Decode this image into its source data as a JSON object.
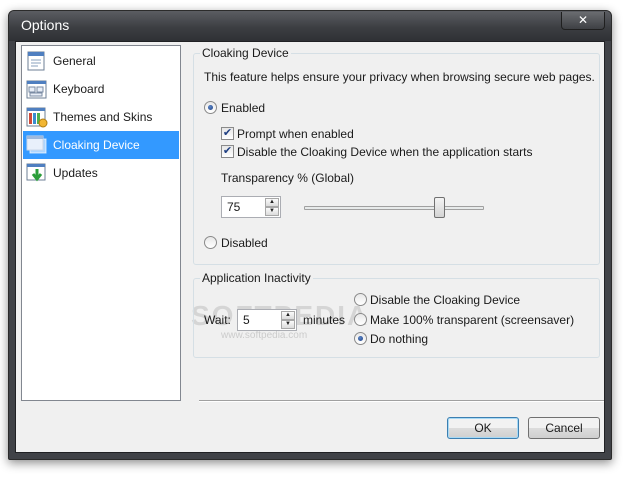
{
  "window": {
    "title": "Options",
    "close_glyph": "✕"
  },
  "nav": {
    "items": [
      {
        "label": "General",
        "icon": "general-icon"
      },
      {
        "label": "Keyboard",
        "icon": "keyboard-icon"
      },
      {
        "label": "Themes and Skins",
        "icon": "themes-icon"
      },
      {
        "label": "Cloaking Device",
        "icon": "cloaking-icon",
        "selected": true
      },
      {
        "label": "Updates",
        "icon": "updates-icon"
      }
    ]
  },
  "cloaking": {
    "group_title": "Cloaking Device",
    "description": "This feature helps ensure your privacy when browsing secure web pages.",
    "enabled_label": "Enabled",
    "enabled_selected": true,
    "prompt_label": "Prompt when enabled",
    "prompt_checked": true,
    "disable_on_start_label": "Disable the Cloaking Device when the application starts",
    "disable_on_start_checked": true,
    "transparency_label": "Transparency % (Global)",
    "transparency_value": "75",
    "transparency_slider_fraction": 0.75,
    "disabled_label": "Disabled"
  },
  "inactivity": {
    "group_title": "Application Inactivity",
    "wait_label": "Wait:",
    "wait_value": "5",
    "minutes_label": "minutes",
    "options": [
      {
        "label": "Disable the Cloaking Device",
        "selected": false
      },
      {
        "label": "Make 100% transparent (screensaver)",
        "selected": false
      },
      {
        "label": "Do nothing",
        "selected": true
      }
    ]
  },
  "buttons": {
    "ok": "OK",
    "cancel": "Cancel"
  },
  "watermark": {
    "text": "SOFTPEDIA",
    "url": "www.softpedia.com"
  },
  "colors": {
    "selection": "#3399ff",
    "titlebar": "#404247",
    "radio_dot": "#1f3f82"
  }
}
